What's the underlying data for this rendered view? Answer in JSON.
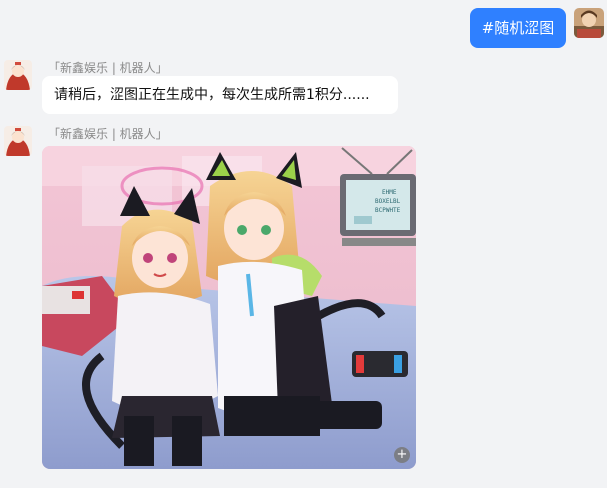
{
  "outgoing": {
    "text": "#随机涩图"
  },
  "messages": [
    {
      "sender": "「新鑫娱乐 | 机器人」",
      "text": "请稍后，涩图正在生成中，每次生成所需1积分......"
    },
    {
      "sender": "「新鑫娱乐 | 机器人」",
      "image_alt": "anime illustration of two cat-eared girls"
    }
  ],
  "image_screen_text": "EHME\nBOXELBL\nBCPWHTE",
  "icons": {
    "zoom": "zoom-in-icon"
  },
  "colors": {
    "accent": "#2f80ff",
    "background": "#f2f3f5"
  }
}
